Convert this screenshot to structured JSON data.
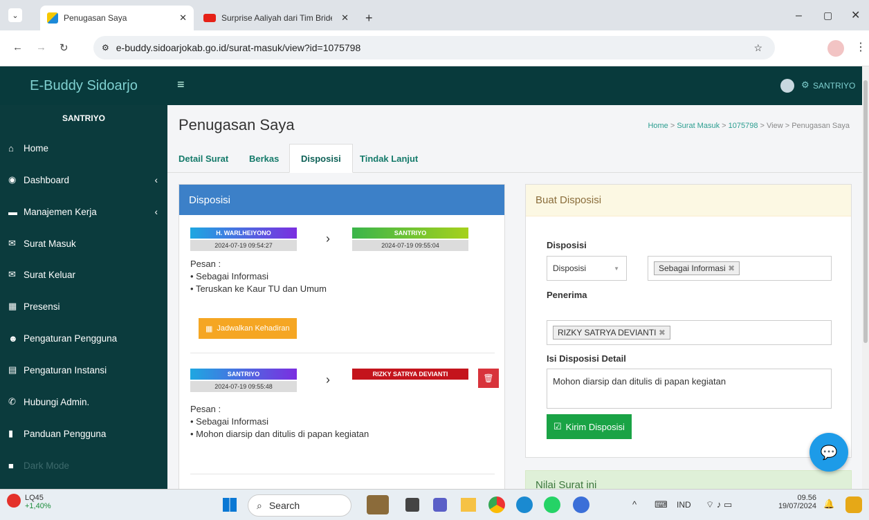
{
  "browser": {
    "tabs": [
      {
        "title": "Penugasan Saya"
      },
      {
        "title": "Surprise Aaliyah dari Tim Brides"
      }
    ],
    "url": "e-buddy.sidoarjokab.go.id/surat-masuk/view?id=1075798"
  },
  "app": {
    "brand": "E-Buddy Sidoarjo",
    "user": "SANTRIYO"
  },
  "sidebar": {
    "user": "SANTRIYO",
    "items": [
      {
        "label": "Home",
        "icon": "home-icon"
      },
      {
        "label": "Dashboard",
        "icon": "dashboard-icon"
      },
      {
        "label": "Manajemen Kerja",
        "icon": "folder-icon"
      },
      {
        "label": "Surat Masuk",
        "icon": "envelope-icon"
      },
      {
        "label": "Surat Keluar",
        "icon": "envelope-icon"
      },
      {
        "label": "Presensi",
        "icon": "calendar-icon"
      },
      {
        "label": "Pengaturan Pengguna",
        "icon": "users-icon"
      },
      {
        "label": "Pengaturan Instansi",
        "icon": "building-icon"
      },
      {
        "label": "Hubungi Admin.",
        "icon": "whatsapp-icon"
      },
      {
        "label": "Panduan Pengguna",
        "icon": "book-icon"
      },
      {
        "label": "Dark Mode",
        "icon": "checkbox-icon"
      }
    ]
  },
  "page": {
    "title": "Penugasan Saya",
    "breadcrumb": [
      "Home",
      "Surat Masuk",
      "1075798",
      "View",
      "Penugasan Saya"
    ],
    "tabs": [
      "Detail Surat",
      "Berkas",
      "Disposisi",
      "Tindak Lanjut"
    ]
  },
  "disposisi": {
    "header": "Disposisi",
    "entries": [
      {
        "from": "H. WARLHEIYONO",
        "from_time": "2024-07-19 09:54:27",
        "to": "SANTRIYO",
        "to_time": "2024-07-19 09:55:04",
        "pesan_label": "Pesan :",
        "items": [
          "Sebagai Informasi",
          "Teruskan ke Kaur TU dan Umum"
        ],
        "button": "Jadwalkan Kehadiran"
      },
      {
        "from": "SANTRIYO",
        "from_time": "2024-07-19 09:55:48",
        "to": "RIZKY SATRYA DEVIANTI",
        "pesan_label": "Pesan :",
        "items": [
          "Sebagai Informasi",
          "Mohon diarsip dan ditulis di papan kegiatan"
        ]
      }
    ]
  },
  "buat": {
    "header": "Buat Disposisi",
    "label_disposisi": "Disposisi",
    "select_value": "Disposisi",
    "chip": "Sebagai Informasi",
    "label_penerima": "Penerima",
    "penerima_chip": "RIZKY SATRYA DEVIANTI",
    "label_isi": "Isi Disposisi Detail",
    "isi_value": "Mohon diarsip dan ditulis di papan kegiatan",
    "submit": "Kirim Disposisi"
  },
  "nilai": {
    "header": "Nilai Surat ini"
  },
  "taskbar": {
    "stock": "LQ45",
    "stock_change": "+1,40%",
    "search": "Search",
    "lang": "IND",
    "time": "09.56",
    "date": "19/07/2024"
  }
}
